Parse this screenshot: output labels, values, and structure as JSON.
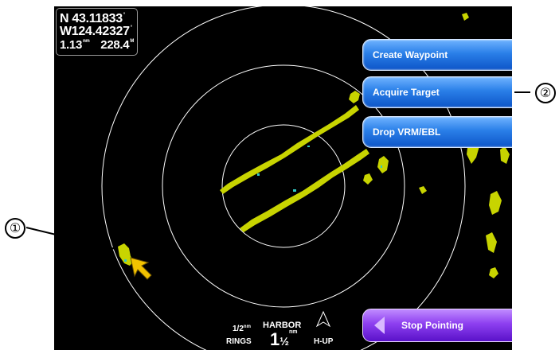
{
  "position": {
    "lat": "N  43.11833",
    "lat_unit": "°",
    "lon": "W124.42327",
    "lon_unit": "°",
    "range": "1.13",
    "range_unit": "nm",
    "bearing": "228.4",
    "bearing_unit": "M"
  },
  "menu": {
    "items": [
      {
        "label": "Create Waypoint"
      },
      {
        "label": "Acquire Target"
      },
      {
        "label": "Drop VRM/EBL"
      }
    ],
    "stop_label": "Stop Pointing"
  },
  "status": {
    "rings_value": "1/2",
    "rings_unit": "nm",
    "rings_label": "RINGS",
    "mode": "HARBOR",
    "range_whole": "1",
    "range_frac": "½",
    "range_unit": "nm",
    "orientation": "H-UP"
  },
  "callouts": {
    "one": "①",
    "two": "②"
  },
  "colors": {
    "echo": "#c8d400",
    "button_blue": "#2a7fe8",
    "button_purple": "#8d3ff0",
    "cursor": "#f2c200"
  }
}
